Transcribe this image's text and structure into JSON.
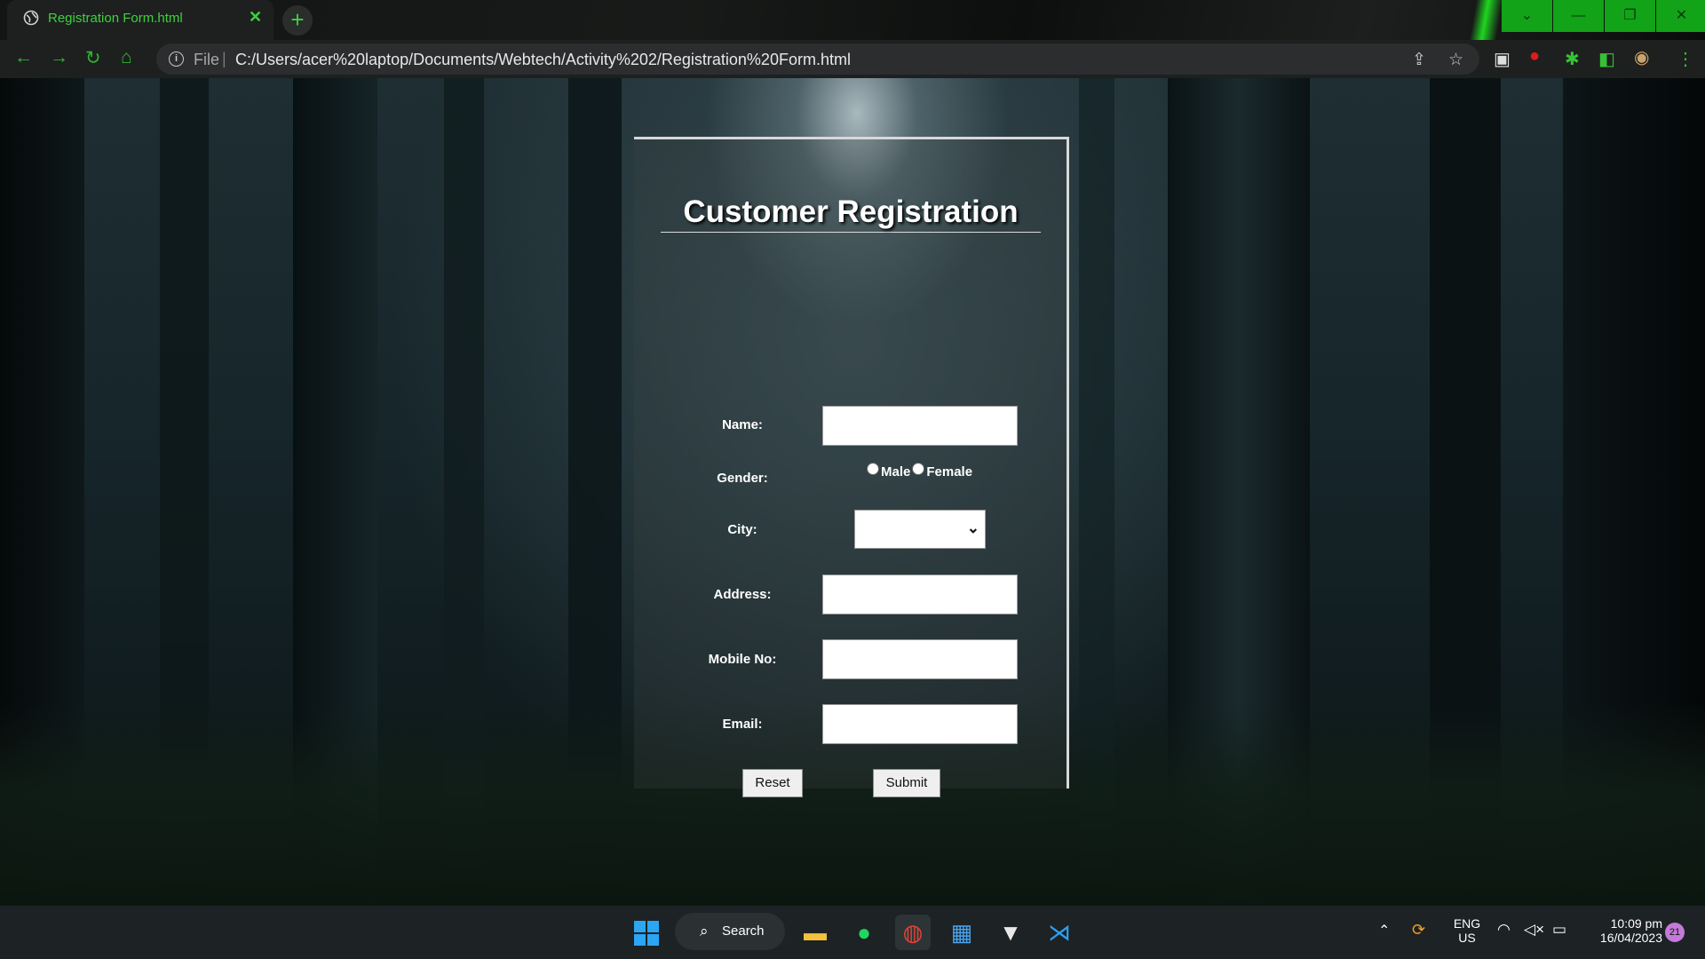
{
  "browser": {
    "tab_title": "Registration Form.html",
    "tab_close": "✕",
    "new_tab": "+",
    "scheme": "File",
    "separator": "|",
    "url": "C:/Users/acer%20laptop/Documents/Webtech/Activity%202/Registration%20Form.html",
    "window_controls": [
      "⌄",
      "—",
      "❐",
      "✕"
    ]
  },
  "form": {
    "title": "Customer Registration",
    "labels": {
      "name": "Name:",
      "gender": "Gender:",
      "city": "City:",
      "address": "Address:",
      "mobile": "Mobile No:",
      "email": "Email:"
    },
    "values": {
      "name": "",
      "city": "",
      "address": "",
      "mobile": "",
      "email": ""
    },
    "gender_options": [
      "Male",
      "Female"
    ],
    "reset_label": "Reset",
    "submit_label": "Submit"
  },
  "taskbar": {
    "search_label": "Search",
    "language": "ENG",
    "region": "US",
    "time": "10:09 pm",
    "date": "16/04/2023",
    "notification_count": "21"
  },
  "colors": {
    "chrome_accent": "#3ed13e",
    "window_controls": "#12a318",
    "taskbar": "#1d2224"
  }
}
